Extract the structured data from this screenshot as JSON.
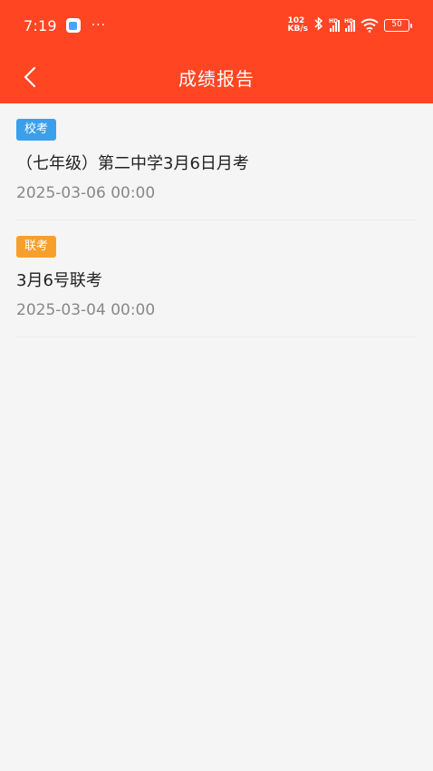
{
  "status_bar": {
    "time": "7:19",
    "more": "···",
    "speed_value": "102",
    "speed_unit": "KB/s",
    "hd1": "HD",
    "hd2": "HD",
    "battery": "50"
  },
  "header": {
    "title": "成绩报告",
    "background": "#ff4522"
  },
  "exams": [
    {
      "tag": "校考",
      "tag_color": "#3aa0ee",
      "title": "（七年级）第二中学3月6日月考",
      "time": "2025-03-06 00:00"
    },
    {
      "tag": "联考",
      "tag_color": "#f5a02d",
      "title": "3月6号联考",
      "time": "2025-03-04 00:00"
    }
  ]
}
